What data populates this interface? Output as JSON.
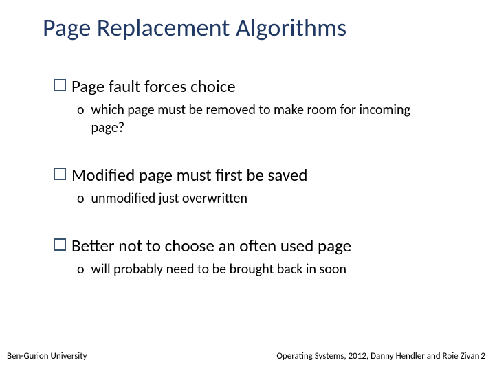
{
  "title": "Page Replacement Algorithms",
  "bullets": [
    {
      "text": "Page fault forces choice",
      "sub": [
        "which page must be removed to make room for incoming page?"
      ]
    },
    {
      "text": "Modified page must first be saved",
      "sub": [
        "unmodified just overwritten"
      ]
    },
    {
      "text": "Better not to choose an often used page",
      "sub": [
        "will probably need to be brought back in soon"
      ]
    }
  ],
  "footer": {
    "left": "Ben-Gurion University",
    "right": "Operating Systems, 2012, Danny Hendler and Roie Zivan",
    "page": "2"
  }
}
